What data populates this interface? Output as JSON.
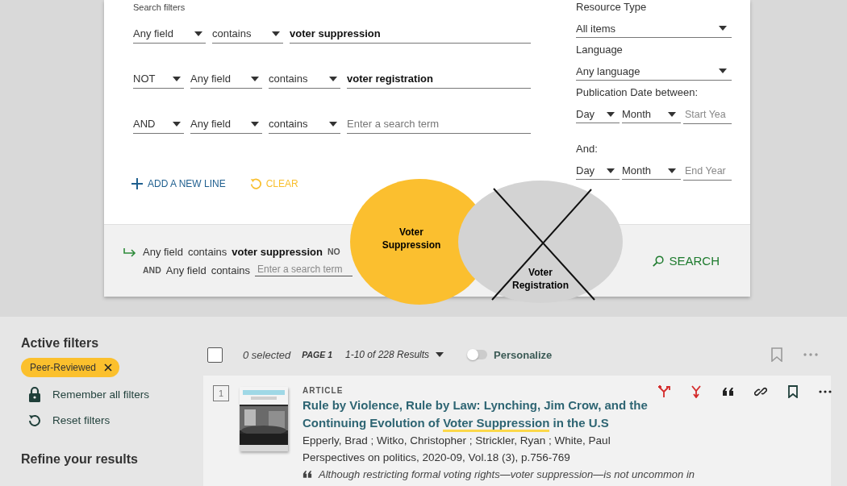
{
  "search_filters": {
    "label": "Search filters",
    "rows": [
      {
        "field": "Any field",
        "condition": "contains",
        "term": "voter suppression"
      },
      {
        "operator": "NOT",
        "field": "Any field",
        "condition": "contains",
        "term": "voter registration"
      },
      {
        "operator": "AND",
        "field": "Any field",
        "condition": "contains",
        "placeholder": "Enter a search term"
      }
    ]
  },
  "actions": {
    "add_line": "ADD A NEW LINE",
    "clear": "CLEAR"
  },
  "side_filters": {
    "resource_type": {
      "label": "Resource Type",
      "value": "All items"
    },
    "language": {
      "label": "Language",
      "value": "Any language"
    },
    "date_label": "Publication Date between:",
    "start": {
      "day": "Day",
      "month": "Month",
      "placeholder": "Start Yea"
    },
    "end_label": "And:",
    "end": {
      "day": "Day",
      "month": "Month",
      "placeholder": "End Year"
    }
  },
  "query_summary": {
    "lines": [
      [
        {
          "kind": "plain",
          "text": "Any field"
        },
        {
          "kind": "plain",
          "text": "contains"
        },
        {
          "kind": "bold",
          "text": "voter suppression"
        },
        {
          "kind": "op",
          "text": "NO"
        }
      ],
      [
        {
          "kind": "op",
          "text": "AND"
        },
        {
          "kind": "plain",
          "text": "Any field"
        },
        {
          "kind": "plain",
          "text": "contains"
        },
        {
          "kind": "input",
          "placeholder": "Enter a search term"
        }
      ]
    ]
  },
  "search_button": "SEARCH",
  "venn": {
    "labels": [
      {
        "lines": [
          "Voter",
          "Suppression"
        ]
      },
      {
        "lines": [
          "Voter",
          "Registration"
        ]
      }
    ]
  },
  "active_filters": {
    "title": "Active filters",
    "chips": [
      {
        "label": "Peer-Reviewed"
      }
    ],
    "actions": [
      {
        "kind": "lock",
        "label": "Remember all filters"
      },
      {
        "kind": "reset",
        "label": "Reset filters"
      }
    ]
  },
  "refine_title": "Refine your results",
  "results_toolbar": {
    "select_all": {
      "checked": false
    },
    "selected_count": "0 selected",
    "page": "PAGE 1",
    "range": "1-10 of 228 Results",
    "personalize": {
      "label": "Personalize",
      "on": false
    }
  },
  "results": [
    {
      "number": "1",
      "type": "ARTICLE",
      "cover": {
        "kind": "picture"
      },
      "title": [
        {
          "text": "Rule by Violence, Rule by Law: Lynching, Jim Crow, and the Continuing Evolution of ",
          "highlighted": false
        },
        {
          "text": "Voter Suppression",
          "highlighted": true
        },
        {
          "text": " in the U.S",
          "highlighted": false
        }
      ],
      "authors": "Epperly, Brad ; Witko, Christopher ; Strickler, Ryan ; White, Paul",
      "source": "Perspectives on politics, 2020-09, Vol.18 (3), p.756-769",
      "snippet": "Although restricting formal voting rights—voter suppression—is not uncommon in"
    }
  ]
}
